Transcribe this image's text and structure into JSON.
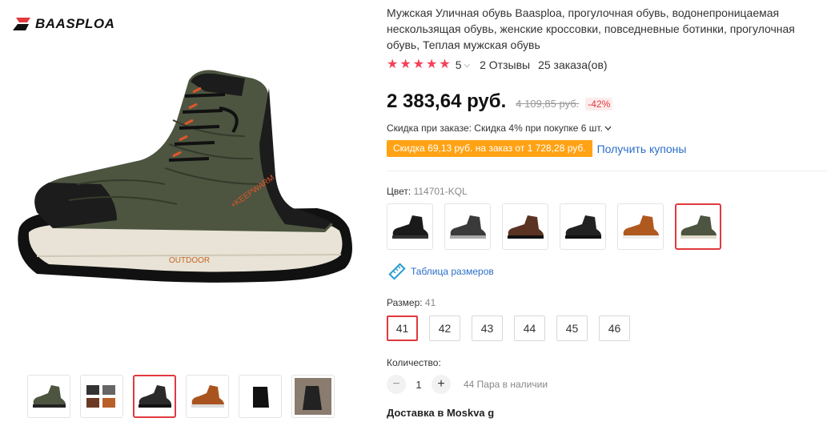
{
  "brand": {
    "name": "BAASPLOA",
    "icon": "baasploa-logo-icon"
  },
  "product": {
    "title": "Мужская Уличная обувь Baasploa, прогулочная обувь, водонепроницаемая нескользящая обувь, женские кроссовки, повседневные ботинки, прогулочная обувь, Теплая мужская обувь",
    "rating": {
      "stars": 5,
      "value": "5",
      "reviews": "2 Отзывы",
      "orders": "25 заказа(ов)"
    },
    "price": "2 383,64 руб.",
    "old_price": "4 109,85 руб.",
    "discount": "-42%",
    "bulk_discount": "Скидка при заказе: Скидка 4% при покупке 6 шт.",
    "coupon_badge": "Скидка 69,13 руб. на заказ от 1 728,28 руб.",
    "coupon_link": "Получить купоны"
  },
  "color": {
    "label": "Цвет:",
    "selected": "114701-KQL",
    "swatches": [
      "black-leather",
      "black-grey",
      "brown-black",
      "black-dark",
      "orange-brown",
      "olive-green"
    ],
    "active_index": 5
  },
  "size_chart": {
    "label": "Таблица размеров",
    "icon": "ruler-icon"
  },
  "size": {
    "label": "Размер:",
    "selected": "41",
    "options": [
      "41",
      "42",
      "43",
      "44",
      "45",
      "46"
    ]
  },
  "quantity": {
    "label": "Количество:",
    "minus": "−",
    "value": "1",
    "plus": "+",
    "stock": "44 Пара в наличии"
  },
  "delivery": "Доставка в Moskva g",
  "colors": {
    "accent": "#e0393e",
    "star": "#f5415a",
    "link": "#2b6ec9",
    "coupon": "#ffa214"
  }
}
